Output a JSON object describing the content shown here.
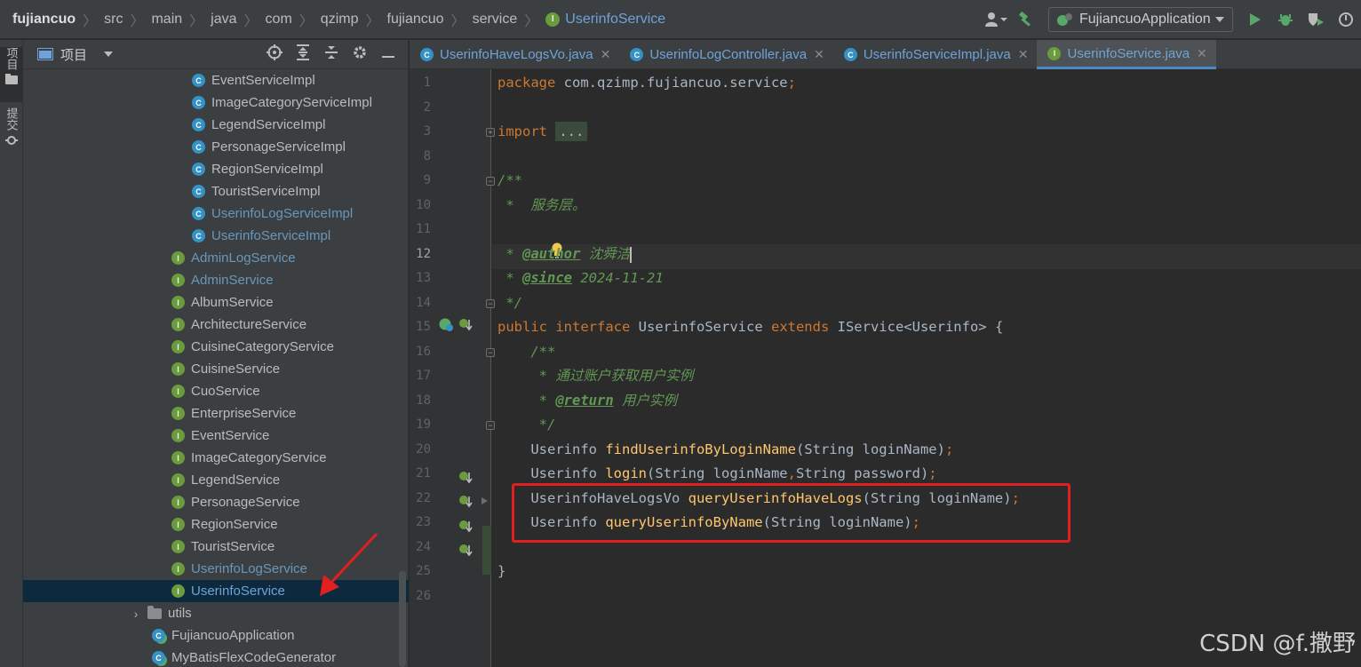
{
  "navbar": {
    "breadcrumbs": [
      "fujiancuo",
      "src",
      "main",
      "java",
      "com",
      "qzimp",
      "fujiancuo",
      "service",
      "UserinfoService"
    ],
    "run_config": "FujiancuoApplication",
    "icon_user": "user-icon",
    "icon_build": "hammer-icon",
    "icon_run": "run-icon",
    "icon_debug": "debug-icon",
    "icon_coverage": "coverage-icon",
    "icon_more": "more-icon"
  },
  "toolstrip": {
    "project_tab": "项目",
    "commit_tab": "提交"
  },
  "project_panel": {
    "title": "项目",
    "tree": [
      {
        "label": "EventServiceImpl",
        "kind": "class",
        "vcs": false
      },
      {
        "label": "ImageCategoryServiceImpl",
        "kind": "class",
        "vcs": false
      },
      {
        "label": "LegendServiceImpl",
        "kind": "class",
        "vcs": false
      },
      {
        "label": "PersonageServiceImpl",
        "kind": "class",
        "vcs": false
      },
      {
        "label": "RegionServiceImpl",
        "kind": "class",
        "vcs": false
      },
      {
        "label": "TouristServiceImpl",
        "kind": "class",
        "vcs": false
      },
      {
        "label": "UserinfoLogServiceImpl",
        "kind": "class",
        "vcs": true
      },
      {
        "label": "UserinfoServiceImpl",
        "kind": "class",
        "vcs": true
      },
      {
        "label": "AdminLogService",
        "kind": "interface",
        "vcs": true
      },
      {
        "label": "AdminService",
        "kind": "interface",
        "vcs": true
      },
      {
        "label": "AlbumService",
        "kind": "interface",
        "vcs": false
      },
      {
        "label": "ArchitectureService",
        "kind": "interface",
        "vcs": false
      },
      {
        "label": "CuisineCategoryService",
        "kind": "interface",
        "vcs": false
      },
      {
        "label": "CuisineService",
        "kind": "interface",
        "vcs": false
      },
      {
        "label": "CuoService",
        "kind": "interface",
        "vcs": false
      },
      {
        "label": "EnterpriseService",
        "kind": "interface",
        "vcs": false
      },
      {
        "label": "EventService",
        "kind": "interface",
        "vcs": false
      },
      {
        "label": "ImageCategoryService",
        "kind": "interface",
        "vcs": false
      },
      {
        "label": "LegendService",
        "kind": "interface",
        "vcs": false
      },
      {
        "label": "PersonageService",
        "kind": "interface",
        "vcs": false
      },
      {
        "label": "RegionService",
        "kind": "interface",
        "vcs": false
      },
      {
        "label": "TouristService",
        "kind": "interface",
        "vcs": false
      },
      {
        "label": "UserinfoLogService",
        "kind": "interface",
        "vcs": true
      },
      {
        "label": "UserinfoService",
        "kind": "interface",
        "vcs": true,
        "selected": true
      },
      {
        "label": "utils",
        "kind": "folder",
        "vcs": false
      },
      {
        "label": "FujiancuoApplication",
        "kind": "app",
        "vcs": false
      },
      {
        "label": "MyBatisFlexCodeGenerator",
        "kind": "app",
        "vcs": false
      }
    ]
  },
  "editor": {
    "tabs": [
      {
        "label": "UserinfoHaveLogsVo.java",
        "kind": "class",
        "active": false
      },
      {
        "label": "UserinfoLogController.java",
        "kind": "class",
        "active": false
      },
      {
        "label": "UserinfoServiceImpl.java",
        "kind": "class",
        "active": false
      },
      {
        "label": "UserinfoService.java",
        "kind": "interface",
        "active": true
      }
    ],
    "current_line": 12,
    "lines": [
      {
        "n": "1",
        "text": "package com.qzimp.fujiancuo.service;"
      },
      {
        "n": "2",
        "text": ""
      },
      {
        "n": "3",
        "text": "import ..."
      },
      {
        "n": "8",
        "text": ""
      },
      {
        "n": "9",
        "text": "/**"
      },
      {
        "n": "10",
        "text": " *  服务层。"
      },
      {
        "n": "11",
        "text": ""
      },
      {
        "n": "12",
        "text": " * @author 沈舜洁"
      },
      {
        "n": "13",
        "text": " * @since 2024-11-21"
      },
      {
        "n": "14",
        "text": " */"
      },
      {
        "n": "15",
        "text": "public interface UserinfoService extends IService<Userinfo> {"
      },
      {
        "n": "16",
        "text": "    /**"
      },
      {
        "n": "17",
        "text": "     * 通过账户获取用户实例"
      },
      {
        "n": "18",
        "text": "     * @return 用户实例"
      },
      {
        "n": "19",
        "text": "     */"
      },
      {
        "n": "20",
        "text": "    Userinfo findUserinfoByLoginName(String loginName);"
      },
      {
        "n": "21",
        "text": "    Userinfo login(String loginName,String password);"
      },
      {
        "n": "22",
        "text": "    UserinfoHaveLogsVo queryUserinfoHaveLogs(String loginName);"
      },
      {
        "n": "23",
        "text": "    Userinfo queryUserinfoByName(String loginName);"
      },
      {
        "n": "24",
        "text": ""
      },
      {
        "n": "25",
        "text": "}"
      },
      {
        "n": "26",
        "text": ""
      }
    ]
  },
  "watermark": "CSDN @f.撒野",
  "colors": {
    "keyword": "#cc7832",
    "comment": "#629755",
    "method": "#ffc66d",
    "plain": "#a9b7c6",
    "vcs_modified": "#6897bb",
    "annotation_box": "#e02020"
  }
}
